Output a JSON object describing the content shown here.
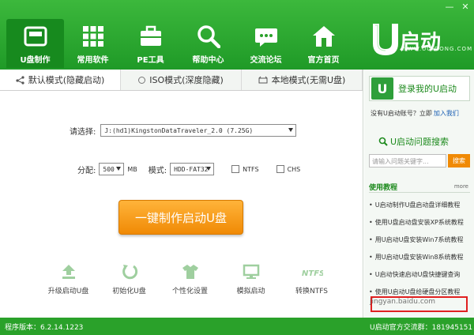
{
  "window": {
    "min": "—",
    "close": "✕"
  },
  "nav": [
    {
      "label": "U盘制作",
      "icon": "usb-drive-icon"
    },
    {
      "label": "常用软件",
      "icon": "apps-grid-icon"
    },
    {
      "label": "PE工具",
      "icon": "toolbox-icon"
    },
    {
      "label": "帮助中心",
      "icon": "magnifier-icon"
    },
    {
      "label": "交流论坛",
      "icon": "chat-bubble-icon"
    },
    {
      "label": "官方首页",
      "icon": "home-icon"
    }
  ],
  "logo": {
    "text": "启动",
    "sub": "WWW.UQIDONG.COM"
  },
  "tabs": [
    {
      "label": "默认模式(隐藏启动)"
    },
    {
      "label": "ISO模式(深度隐藏)"
    },
    {
      "label": "本地模式(无需U盘)"
    }
  ],
  "form": {
    "select_label": "请选择:",
    "device": "J:(hd1)KingstonDataTraveler_2.0 (7.25G)",
    "alloc_label": "分配:",
    "alloc_value": "500",
    "alloc_unit": "MB",
    "mode_label": "模式:",
    "mode_value": "HDD-FAT32",
    "ntfs": "NTFS",
    "chs": "CHS"
  },
  "main_button": "一键制作启动U盘",
  "tools": [
    {
      "label": "升级启动U盘",
      "icon": "upgrade-icon"
    },
    {
      "label": "初始化U盘",
      "icon": "refresh-icon"
    },
    {
      "label": "个性化设置",
      "icon": "shirt-icon"
    },
    {
      "label": "模拟启动",
      "icon": "monitor-icon"
    },
    {
      "label": "转换NTFS",
      "icon": "ntfs-icon"
    }
  ],
  "side": {
    "login": "登录我的U启动",
    "no_account": "没有U启动账号？立即",
    "join": "加入我们",
    "search_title": "U启动问题搜索",
    "search_placeholder": "请输入问题关键字...",
    "search_btn": "搜索",
    "tut_title": "使用教程",
    "more": "more",
    "tutorials": [
      "U启动制作U盘启动盘详细教程",
      "使用U盘启动盘安装XP系统教程",
      "用U启动U盘安装Win7系统教程",
      "用U启动U盘安装Win8系统教程",
      "U启动快速启动U盘快捷键查询",
      "使用U启动U盘给硬盘分区教程"
    ]
  },
  "watermark": "jingyan.baidu.com",
  "status": {
    "version": "程序版本：6.2.14.1223",
    "qq": "U启动官方交流群：181945151"
  },
  "colors": {
    "brand_green": "#1f9a27",
    "button_orange": "#f08a05",
    "highlight_red": "#e02020"
  }
}
